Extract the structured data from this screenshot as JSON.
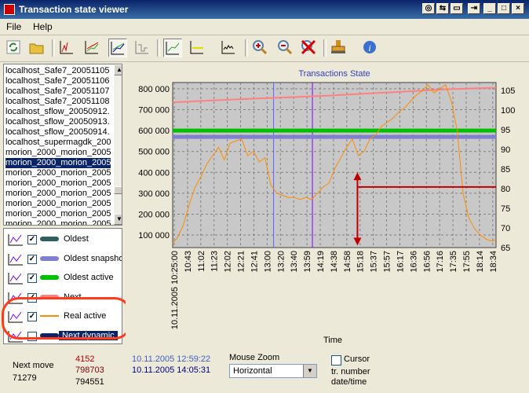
{
  "window": {
    "title": "Transaction state viewer"
  },
  "menu": [
    {
      "label": "File"
    },
    {
      "label": "Help"
    }
  ],
  "toolbar": {
    "icons": [
      "refresh-icon",
      "open-folder-icon",
      "chart-1-icon",
      "chart-2-icon",
      "chart-3-icon",
      "chart-4-icon",
      "chart-5-icon",
      "chart-6-icon",
      "chart-7-icon",
      "zoom-in-icon",
      "zoom-out-icon",
      "zoom-reset-icon",
      "stamp-icon",
      "info-icon"
    ]
  },
  "files": [
    "localhost_Safe7_20051105",
    "localhost_Safe7_20051106",
    "localhost_Safe7_20051107",
    "localhost_Safe7_20051108",
    "localhost_sflow_20050912.",
    "localhost_sflow_20050913.",
    "localhost_sflow_20050914.",
    "localhost_supermagdk_200",
    "morion_2000_morion_2005",
    "morion_2000_morion_2005",
    "morion_2000_morion_2005",
    "morion_2000_morion_2005",
    "morion_2000_morion_2005",
    "morion_2000_morion_2005",
    "morion_2000_morion_2005",
    "morion_2000_morion_2005"
  ],
  "selected_file_index": 9,
  "legend": [
    {
      "label": "Oldest",
      "color": "#2f6060",
      "checked": true
    },
    {
      "label": "Oldest snapshot",
      "color": "#8080d0",
      "checked": true
    },
    {
      "label": "Oldest active",
      "color": "#00c000",
      "checked": true
    },
    {
      "label": "Next",
      "color": "#ff8080",
      "checked": true
    },
    {
      "label": "Real active",
      "color": "#ff8c00",
      "checked": true
    },
    {
      "label": "Next dynamic",
      "color": "#0a246a",
      "checked": false
    }
  ],
  "status": {
    "next_move_label": "Next move",
    "next_move_value": "71279",
    "val_red1": "4152",
    "val_red2": "798703",
    "val_black": "794551",
    "date1": "10.11.2005 12:59:22",
    "date2": "10.11.2005 14:05:31",
    "mouse_zoom_label": "Mouse Zoom",
    "mouse_zoom_value": "Horizontal",
    "cursor_label": "Cursor",
    "tr_number_label": "tr. number",
    "date_time_label": "date/time"
  },
  "chart_data": {
    "type": "line",
    "title": "Transactions State",
    "xlabel": "Time",
    "ylabel": "",
    "x_ticks": [
      "10.11.2005 10:25:00",
      "10:43",
      "11:02",
      "11:23",
      "12:02",
      "12:21",
      "12:41",
      "13:00",
      "13:20",
      "13:40",
      "13:59",
      "14:19",
      "14:38",
      "14:58",
      "15:18",
      "15:37",
      "15:57",
      "16:17",
      "16:36",
      "16:56",
      "17:16",
      "17:35",
      "17:55",
      "18:14",
      "18:34"
    ],
    "y_left_ticks": [
      "100 000",
      "200 000",
      "300 000",
      "400 000",
      "500 000",
      "600 000",
      "700 000",
      "800 000"
    ],
    "y_left_lim": [
      40000,
      830000
    ],
    "y_right_ticks": [
      "65",
      "70",
      "75",
      "80",
      "85",
      "90",
      "95",
      "100",
      "105"
    ],
    "y_right_lim": [
      65,
      107
    ],
    "grid": true,
    "vlines": [
      {
        "x": 13.02,
        "color": "#6060ff"
      },
      {
        "x": 14.02,
        "color": "#8000ff"
      }
    ],
    "series": [
      {
        "name": "Oldest snapshot",
        "color": "#8080d0",
        "axis": "left",
        "x": [
          10.42,
          18.75
        ],
        "y": [
          570000,
          570000
        ]
      },
      {
        "name": "Oldest active",
        "color": "#00c000",
        "axis": "left",
        "x": [
          10.42,
          18.75
        ],
        "y": [
          600000,
          600000
        ]
      },
      {
        "name": "Next",
        "color": "#ff8080",
        "axis": "left",
        "x": [
          10.42,
          11.5,
          12.5,
          13.5,
          14.5,
          15.5,
          16.5,
          17.5,
          18.75
        ],
        "y": [
          735000,
          745000,
          753000,
          760000,
          768000,
          778000,
          788000,
          798000,
          805000
        ]
      },
      {
        "name": "Real active",
        "color": "#ff8c00",
        "axis": "left",
        "x": [
          10.42,
          10.55,
          10.7,
          10.85,
          11.0,
          11.15,
          11.3,
          11.45,
          11.6,
          11.75,
          11.9,
          12.05,
          12.2,
          12.35,
          12.5,
          12.65,
          12.8,
          12.95,
          13.1,
          13.25,
          13.4,
          13.55,
          13.7,
          13.85,
          14.0,
          14.15,
          14.3,
          14.45,
          14.6,
          14.75,
          14.9,
          15.05,
          15.2,
          15.35,
          15.5,
          15.65,
          15.8,
          15.95,
          16.1,
          16.25,
          16.4,
          16.55,
          16.7,
          16.85,
          17.0,
          17.15,
          17.3,
          17.45,
          17.6,
          17.75,
          17.9,
          18.05,
          18.2,
          18.35,
          18.5,
          18.65,
          18.75
        ],
        "y": [
          60000,
          90000,
          150000,
          250000,
          330000,
          380000,
          440000,
          480000,
          520000,
          460000,
          540000,
          550000,
          560000,
          480000,
          500000,
          450000,
          470000,
          340000,
          300000,
          290000,
          280000,
          280000,
          270000,
          280000,
          270000,
          300000,
          330000,
          350000,
          420000,
          470000,
          520000,
          560000,
          480000,
          500000,
          560000,
          580000,
          620000,
          640000,
          660000,
          690000,
          710000,
          740000,
          770000,
          790000,
          820000,
          780000,
          800000,
          820000,
          740000,
          600000,
          300000,
          180000,
          130000,
          100000,
          80000,
          70000,
          80000
        ]
      }
    ],
    "marker": {
      "x_arrow": 15.18,
      "y_top": 400000,
      "y_bottom": 50000,
      "h_y": 330000,
      "color": "#c00000"
    }
  }
}
